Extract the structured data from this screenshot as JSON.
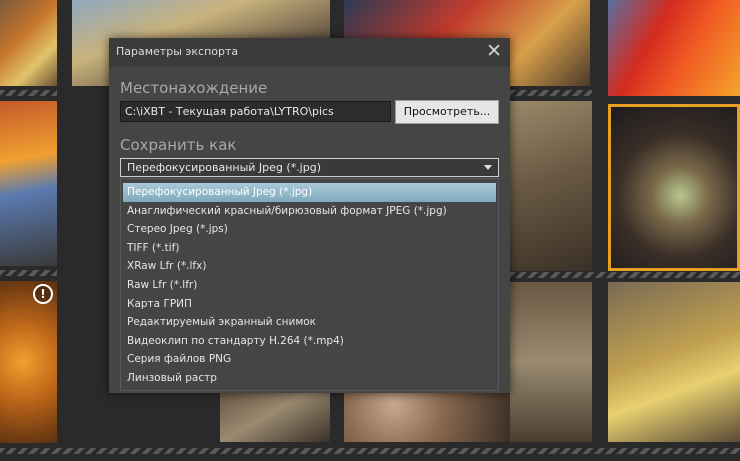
{
  "dialog": {
    "title": "Параметры экспорта",
    "close_glyph": "✕",
    "location_label": "Местонахождение",
    "path_value": "C:\\iXBT - Текущая работа\\LYTRO\\pics",
    "browse_label": "Просмотреть...",
    "save_as_label": "Сохранить как",
    "selected_format": "Перефокусированный Jpeg (*.jpg)",
    "options": [
      "Перефокусированный Jpeg (*.jpg)",
      "Анаглифический красный/бирюзовый формат JPEG (*.jpg)",
      "Стерео Jpeg (*.jps)",
      "TIFF (*.tif)",
      "XRaw Lfr (*.lfx)",
      "Raw Lfr (*.lfr)",
      "Карта ГРИП",
      "Редактируемый экранный снимок",
      "Видеоклип по стандарту H.264 (*.mp4)",
      "Серия файлов PNG",
      "Линзовый растр"
    ]
  },
  "gallery": {
    "warning_glyph": "!"
  },
  "colors": {
    "selection_border": "#e8a020",
    "dialog_bg": "#454545",
    "highlight": "#8fb5c8"
  }
}
